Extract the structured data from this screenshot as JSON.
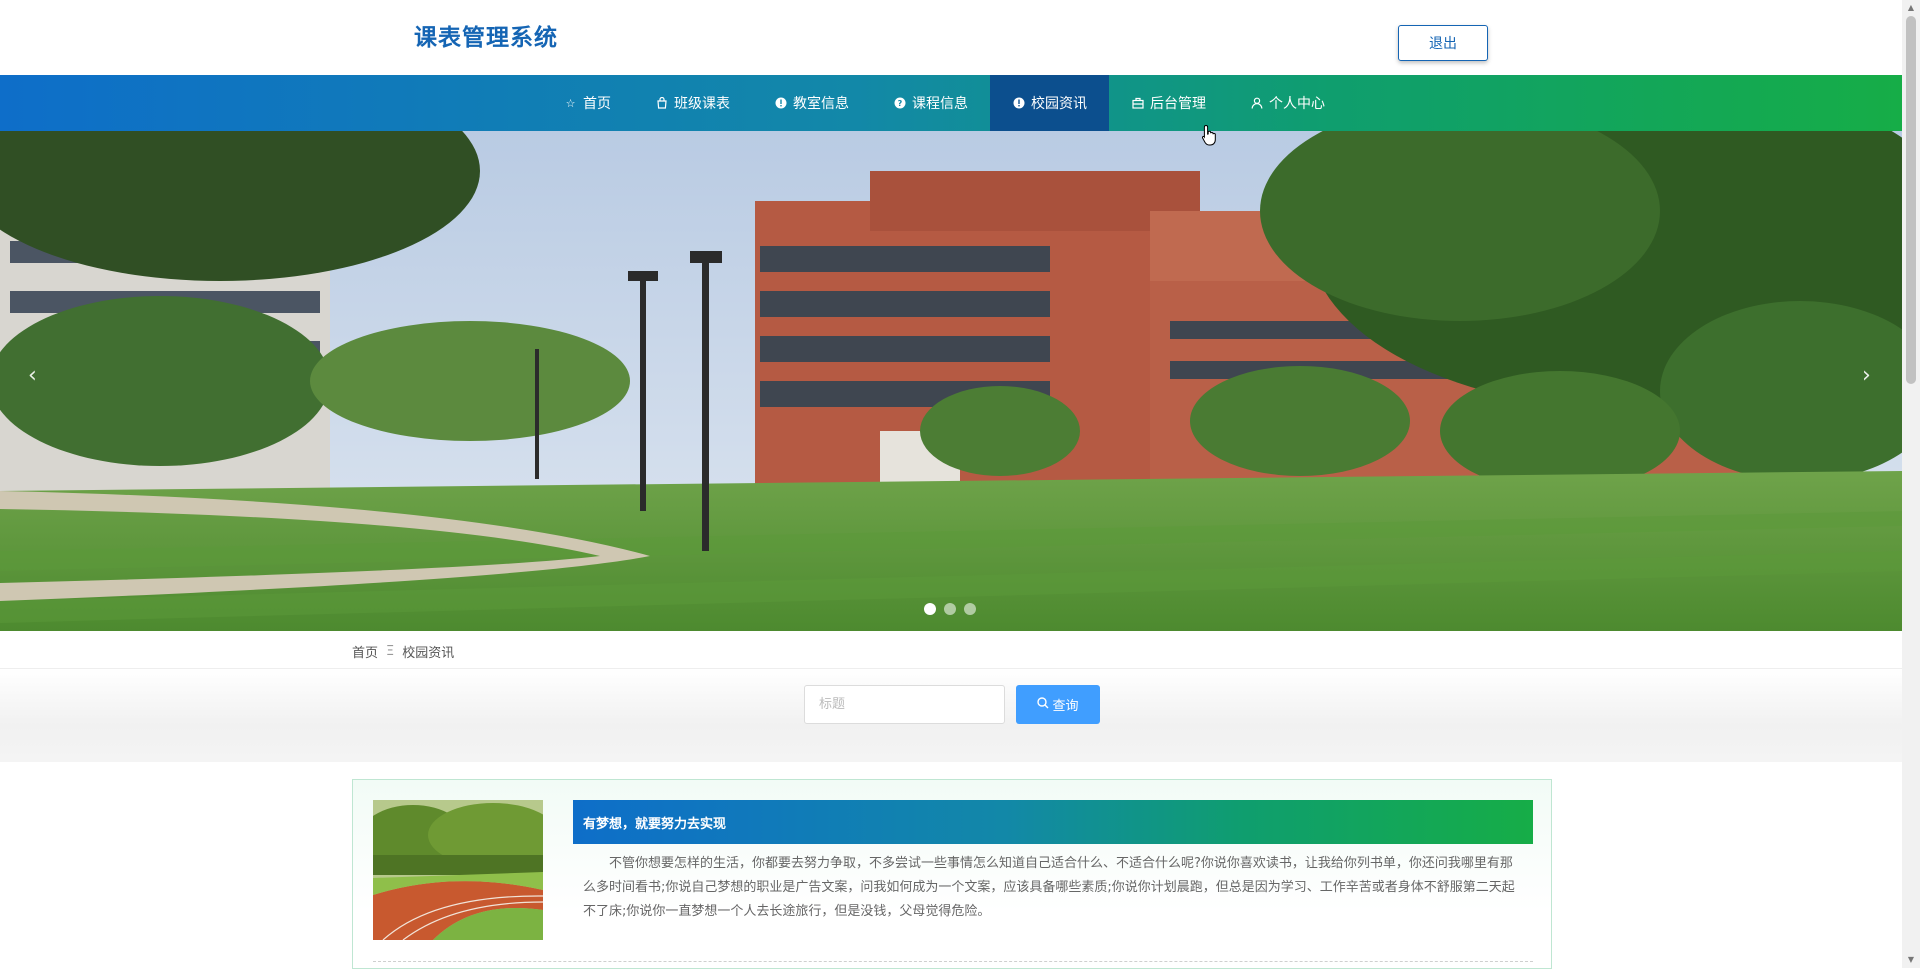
{
  "header": {
    "title": "课表管理系统",
    "logout_label": "退出"
  },
  "nav": {
    "items": [
      {
        "label": "首页",
        "icon": "star-icon"
      },
      {
        "label": "班级课表",
        "icon": "bag-icon"
      },
      {
        "label": "教室信息",
        "icon": "info-icon"
      },
      {
        "label": "课程信息",
        "icon": "question-icon"
      },
      {
        "label": "校园资讯",
        "icon": "info-icon",
        "active": true
      },
      {
        "label": "后台管理",
        "icon": "briefcase-icon"
      },
      {
        "label": "个人中心",
        "icon": "user-icon"
      }
    ]
  },
  "banner": {
    "prev_symbol": "‹",
    "next_symbol": "›",
    "slide_count": 3,
    "active_slide": 1
  },
  "breadcrumb": {
    "home": "首页",
    "separator": "Ξ",
    "current": "校园资讯"
  },
  "search": {
    "placeholder": "标题",
    "button_label": "查询"
  },
  "news": [
    {
      "title": "有梦想，就要努力去实现",
      "body": "不管你想要怎样的生活，你都要去努力争取，不多尝试一些事情怎么知道自己适合什么、不适合什么呢?你说你喜欢读书，让我给你列书单，你还问我哪里有那么多时间看书;你说自己梦想的职业是广告文案，问我如何成为一个文案，应该具备哪些素质;你说你计划晨跑，但总是因为学习、工作辛苦或者身体不舒服第二天起不了床;你说你一直梦想一个人去长途旅行，但是没钱，父母觉得危险。"
    }
  ],
  "colors": {
    "brand_blue": "#1565b4",
    "nav_gradient_start": "#0e6ec9",
    "nav_gradient_end": "#16ad47",
    "nav_active": "#0c4f8e",
    "search_button": "#409eff"
  }
}
